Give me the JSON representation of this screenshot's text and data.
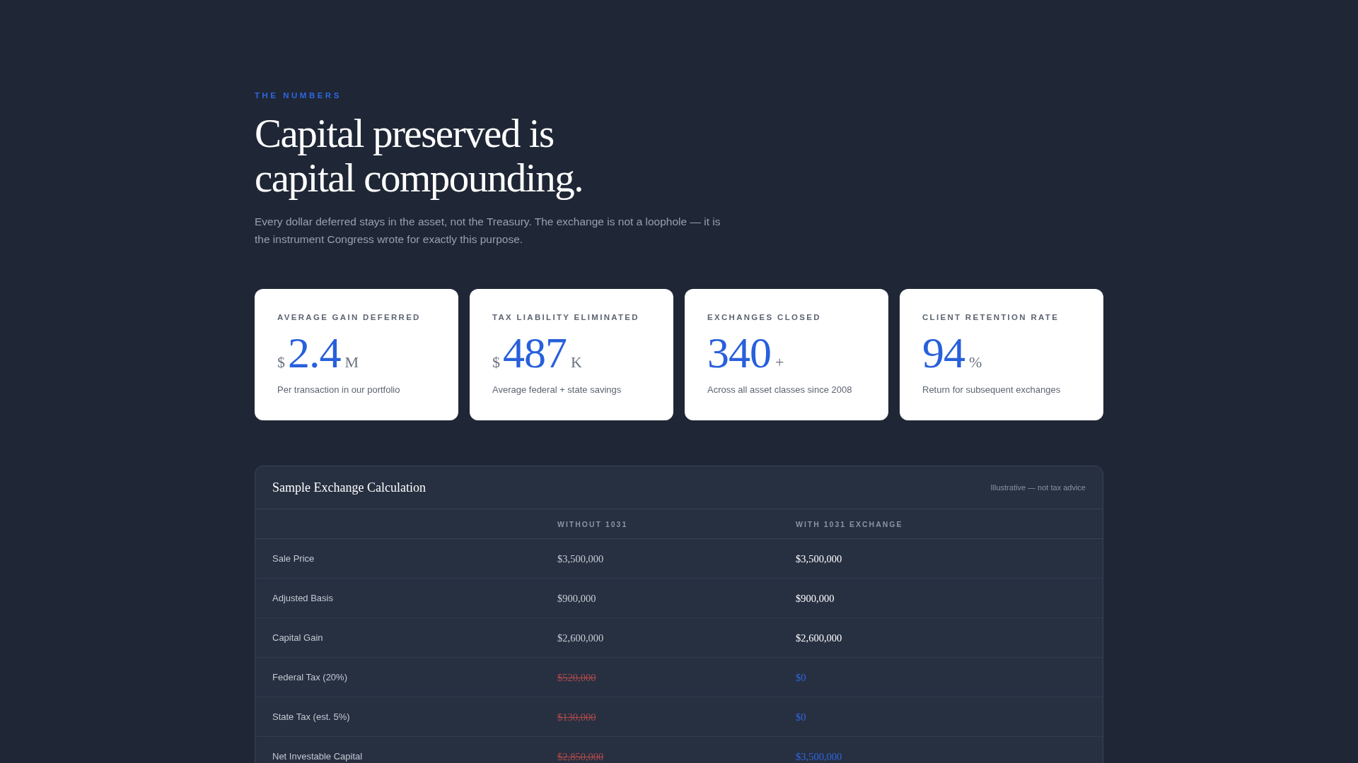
{
  "eyebrow": "THE NUMBERS",
  "heading_lines": [
    "Capital preserved is",
    "capital compounding."
  ],
  "intro": "Every dollar deferred stays in the asset, not the Treasury. The exchange is not a loophole — it is the instrument Congress wrote for exactly this purpose.",
  "stats": [
    {
      "label": "AVERAGE GAIN DEFERRED",
      "prefix": "$",
      "value": "2.4",
      "suffix": "M",
      "caption": "Per transaction in our portfolio"
    },
    {
      "label": "TAX LIABILITY ELIMINATED",
      "prefix": "$",
      "value": "487",
      "suffix": "K",
      "caption": "Average federal + state savings"
    },
    {
      "label": "EXCHANGES CLOSED",
      "value": "340",
      "suffix": "+",
      "caption": "Across all asset classes since 2008"
    },
    {
      "label": "CLIENT RETENTION RATE",
      "value": "94",
      "suffix": "%",
      "caption": "Return for subsequent exchanges"
    }
  ],
  "table": {
    "title": "Sample Exchange Calculation",
    "note": "Illustrative — not tax advice",
    "columns": [
      "WITHOUT 1031",
      "WITH 1031 EXCHANGE"
    ],
    "rows": [
      {
        "label": "Sale Price",
        "without": {
          "text": "$3,500,000",
          "struck": false
        },
        "with": {
          "text": "$3,500,000",
          "highlight": false
        }
      },
      {
        "label": "Adjusted Basis",
        "without": {
          "text": "$900,000",
          "struck": false
        },
        "with": {
          "text": "$900,000",
          "highlight": false
        }
      },
      {
        "label": "Capital Gain",
        "without": {
          "text": "$2,600,000",
          "struck": false
        },
        "with": {
          "text": "$2,600,000",
          "highlight": false
        }
      },
      {
        "label": "Federal Tax (20%)",
        "without": {
          "text": "$520,000",
          "struck": true
        },
        "with": {
          "text": "$0",
          "highlight": true
        }
      },
      {
        "label": "State Tax (est. 5%)",
        "without": {
          "text": "$130,000",
          "struck": true
        },
        "with": {
          "text": "$0",
          "highlight": true
        }
      },
      {
        "label": "Net Investable Capital",
        "without": {
          "text": "$2,850,000",
          "struck": true
        },
        "with": {
          "text": "$3,500,000",
          "highlight": true
        }
      }
    ]
  }
}
